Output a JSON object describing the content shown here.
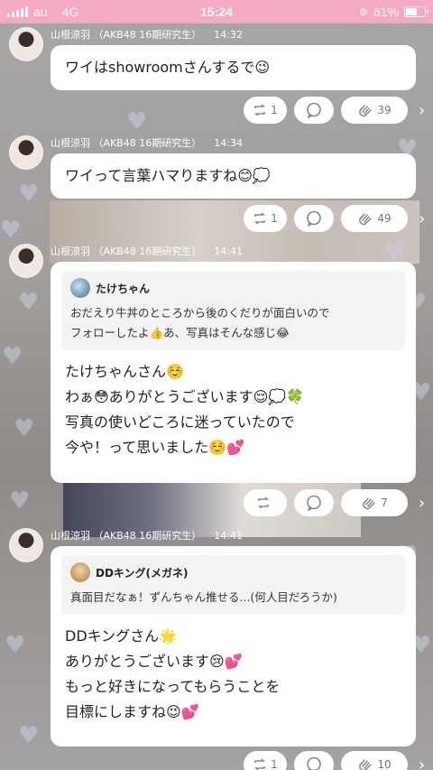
{
  "status_bar": {
    "carrier": "au",
    "network": "4G",
    "time": "15:24",
    "battery": "61%",
    "battery_level": 0.61
  },
  "posts": [
    {
      "author": "山根涼羽 （AKB48 16期研究生）",
      "time": "14:32",
      "lines": [
        "ワイはshowroomさんするで😉"
      ],
      "retweets": "1",
      "claps": "39"
    },
    {
      "author": "山根涼羽 （AKB48 16期研究生）",
      "time": "14:34",
      "lines": [
        "ワイって言葉ハマりますね😊💭"
      ],
      "retweets": "1",
      "claps": "49"
    },
    {
      "author": "山根涼羽 （AKB48 16期研究生）",
      "time": "14:41",
      "quote": {
        "name": "たけちゃん",
        "lines": [
          "おだえり牛丼のところから後のくだりが面白いので",
          "フォローしたよ👍あ、写真はそんな感じ😂"
        ]
      },
      "lines": [
        "たけちゃんさん☺️",
        "わぁ😳ありがとうございます😌💭🍀",
        "写真の使いどころに迷っていたので",
        "今や！って思いました☺️💕"
      ],
      "retweets": "",
      "claps": "7"
    },
    {
      "author": "山根涼羽 （AKB48 16期研究生）",
      "time": "14:41",
      "quote": {
        "name": "DDキング(メガネ)",
        "lines": [
          "真面目だなぁ！ずんちゃん推せる...(何人目だろうか)"
        ]
      },
      "lines": [
        "DDキングさん🌟",
        "ありがとうございます😢💕",
        "もっと好きになってもらうことを",
        "目標にしますね😉💕"
      ],
      "retweets": "1",
      "claps": "10"
    }
  ],
  "icons": {
    "retweet": "retweet-icon",
    "comment": "comment-icon",
    "clap": "clap-icon",
    "more": "chevron-right-icon"
  }
}
